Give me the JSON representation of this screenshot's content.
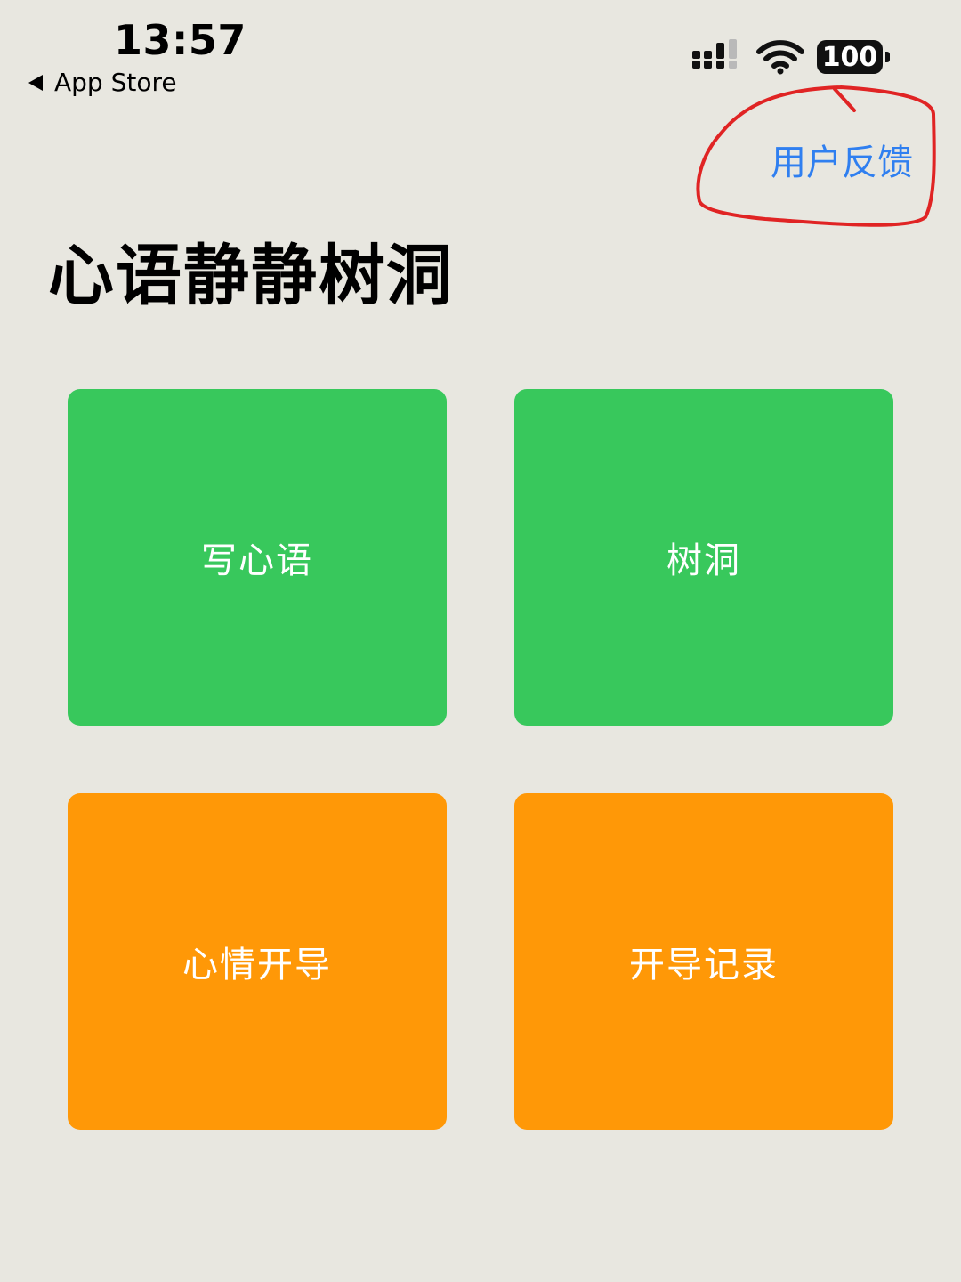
{
  "status_bar": {
    "time": "13:57",
    "back_label": "App Store",
    "battery": "100",
    "icons": [
      "signal-icon",
      "wifi-icon",
      "battery-icon"
    ]
  },
  "header": {
    "feedback_label": "用户反馈",
    "title": "心语静静树洞"
  },
  "tiles": [
    {
      "label": "写心语",
      "color": "#38c85c"
    },
    {
      "label": "树洞",
      "color": "#38c85c"
    },
    {
      "label": "心情开导",
      "color": "#ff9807"
    },
    {
      "label": "开导记录",
      "color": "#ff9807"
    }
  ],
  "colors": {
    "background": "#e8e7e0",
    "link": "#2f7ff0",
    "annotation": "#e02424"
  }
}
